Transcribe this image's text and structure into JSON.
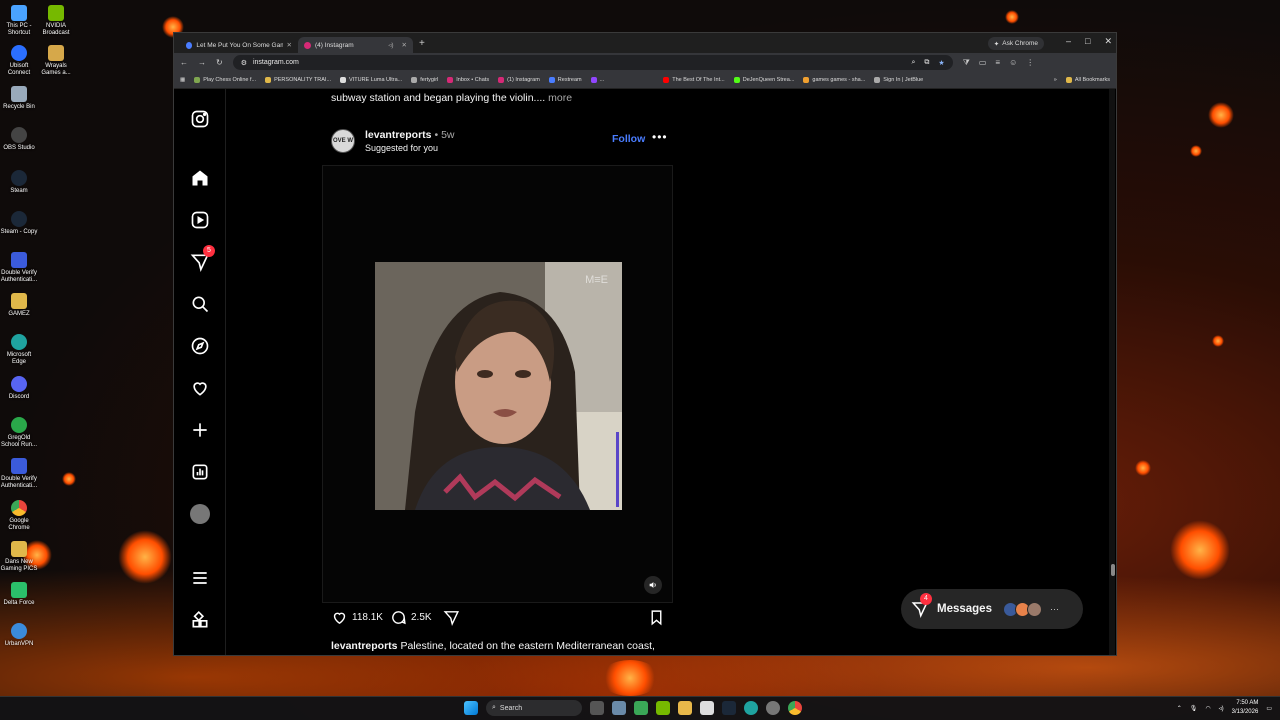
{
  "desktop": {
    "icons": [
      {
        "label": "This PC - Shortcut",
        "color": "#4aa3ff"
      },
      {
        "label": "NVIDIA Broadcast",
        "color": "#76b900"
      },
      {
        "label": "Ubisoft Connect",
        "color": "#2b6fff"
      },
      {
        "label": "Wrayals Games a...",
        "color": "#d6a84a"
      },
      {
        "label": "Recycle Bin",
        "color": "#9ab"
      },
      {
        "label": "OBS Studio",
        "color": "#444"
      },
      {
        "label": "Steam",
        "color": "#1b2838"
      },
      {
        "label": "Steam - Copy",
        "color": "#1b2838"
      },
      {
        "label": "Double Verify Authenticati...",
        "color": "#3b5bdb"
      },
      {
        "label": "GAMEZ",
        "color": "#e0b84a"
      },
      {
        "label": "Microsoft Edge",
        "color": "#1fa3a0"
      },
      {
        "label": "Discord",
        "color": "#5865f2"
      },
      {
        "label": "GregOld School Run...",
        "color": "#2aa84a"
      },
      {
        "label": "Double Verify Authenticati...",
        "color": "#3b5bdb"
      },
      {
        "label": "Google Chrome",
        "color": "#e8453c"
      },
      {
        "label": "Dans New Gaming PICS",
        "color": "#e0b84a"
      },
      {
        "label": "Delta Force",
        "color": "#2bbf6a"
      },
      {
        "label": "UrbanVPN",
        "color": "#3b8bdb"
      }
    ]
  },
  "browser": {
    "tabs": [
      {
        "title": "Let Me Put You On Some Gam...",
        "active": false,
        "color": "#4a7dff"
      },
      {
        "title": "(4) Instagram",
        "active": true,
        "color": "#d62976"
      }
    ],
    "new_tab": "+",
    "ask_chrome": "Ask Chrome",
    "controls": {
      "minimize": "–",
      "maximize": "□",
      "close": "✕"
    },
    "nav": {
      "back": "←",
      "forward": "→",
      "reload": "↻"
    },
    "url": "instagram.com",
    "bookmarks": [
      {
        "label": "Play Chess Online f...",
        "color": "#7fa650"
      },
      {
        "label": "PERSONALITY TRAI...",
        "color": "#e0b84a"
      },
      {
        "label": "VITURE Luma Ultra...",
        "color": "#ddd"
      },
      {
        "label": "fertygirl",
        "color": "#aaa"
      },
      {
        "label": "Inbox • Chats",
        "color": "#d62976"
      },
      {
        "label": "(1) Instagram",
        "color": "#d62976"
      },
      {
        "label": "Restream",
        "color": "#4a7dff"
      },
      {
        "label": "...",
        "color": "#9146ff"
      },
      {
        "label": "The Best Of The Int...",
        "color": "#ff0000"
      },
      {
        "label": "DeJenQueen Strea...",
        "color": "#53fc18"
      },
      {
        "label": "games games - sha...",
        "color": "#f0a030"
      },
      {
        "label": "Sign In | JetBlue",
        "color": "#aaa"
      }
    ],
    "all_bookmarks": "All Bookmarks"
  },
  "instagram": {
    "nav_badge": "5",
    "prev_caption": "subway station and began playing the violin....",
    "prev_caption_more": "more",
    "post": {
      "username": "levantreports",
      "separator": "•",
      "age": "5w",
      "subtitle": "Suggested for you",
      "follow_label": "Follow",
      "more_label": "•••",
      "avatar_text": "OVE W",
      "likes": "118.1K",
      "comments": "2.5K",
      "caption_user": "levantreports",
      "caption_text": "Palestine, located on the eastern Mediterranean coast,",
      "watermark": "M≡E"
    },
    "messages": {
      "label": "Messages",
      "badge": "4",
      "more": "···"
    }
  },
  "taskbar": {
    "search_label": "Search",
    "time": "7:50 AM",
    "date": "3/13/2026"
  }
}
